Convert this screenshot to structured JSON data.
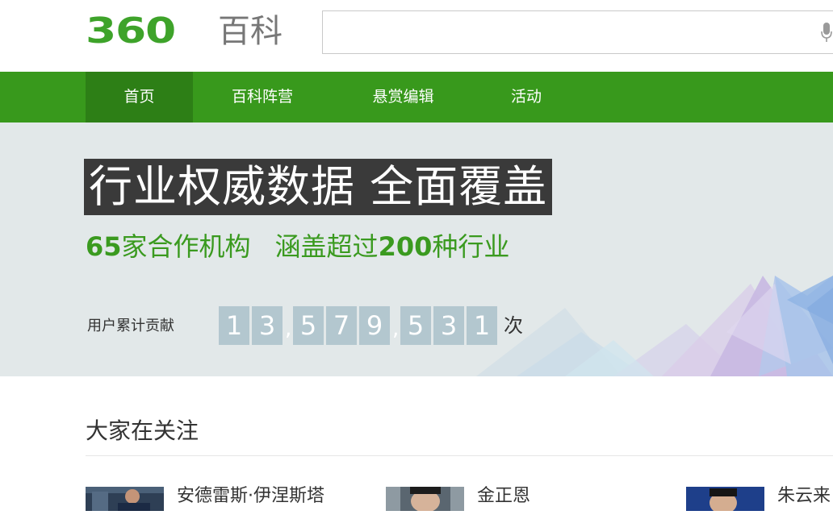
{
  "logo": {
    "number": "360",
    "text": "百科"
  },
  "search": {
    "value": "",
    "placeholder": ""
  },
  "nav": {
    "items": [
      {
        "label": "首页",
        "active": true
      },
      {
        "label": "百科阵营",
        "active": false
      },
      {
        "label": "悬赏编辑",
        "active": false
      },
      {
        "label": "活动",
        "active": false
      }
    ]
  },
  "banner": {
    "headline": "行业权威数据 全面覆盖",
    "sub_num1": "65",
    "sub_text1": "家合作机构",
    "sub_text2": "涵盖超过",
    "sub_num2": "200",
    "sub_text3": "种行业",
    "contrib_label": "用户累计贡献",
    "counter": "13,579,531",
    "counter_unit": "次"
  },
  "attention": {
    "title": "大家在关注",
    "people": [
      {
        "name": "安德雷斯·伊涅斯塔"
      },
      {
        "name": "金正恩"
      },
      {
        "name": "朱云来"
      }
    ]
  },
  "colors": {
    "brand_green": "#38991c",
    "nav_active": "#2d7f16",
    "banner_bg": "#e2e8e9",
    "digit_bg": "#b3c7cf"
  }
}
